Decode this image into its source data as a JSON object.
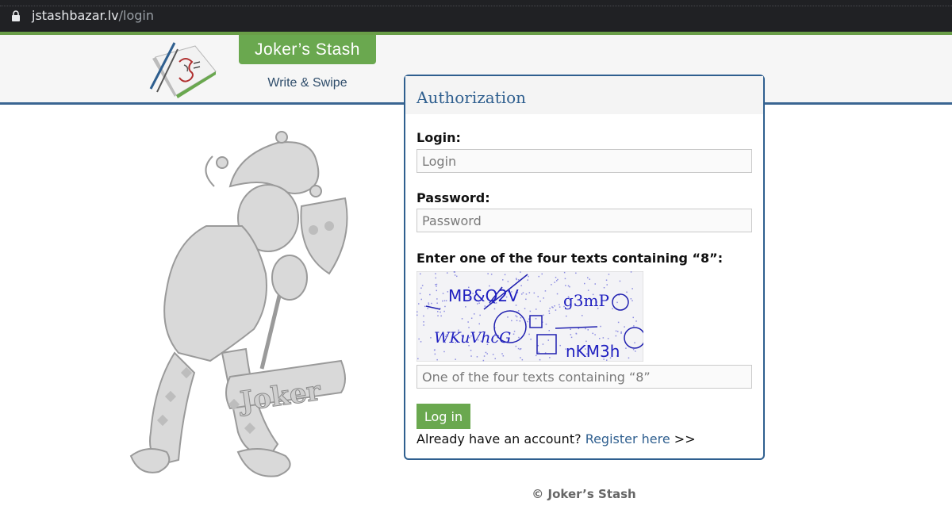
{
  "browser": {
    "url_host": "jstashbazar.lv",
    "url_path": "/login",
    "lock_icon": "lock-icon"
  },
  "header": {
    "brand": "Joker’s Stash",
    "tagline": "Write & Swipe",
    "colors": {
      "green": "#6aa84f",
      "blue": "#2f5f8f"
    }
  },
  "auth": {
    "title": "Authorization",
    "login_label": "Login:",
    "login_placeholder": "Login",
    "password_label": "Password:",
    "password_placeholder": "Password",
    "captcha_label": "Enter one of the four texts containing “8”:",
    "captcha_texts": [
      "MB&Q2V",
      "g3mP",
      "WKuVhcG",
      "nKM3h"
    ],
    "captcha_placeholder": "One of the four texts containing “8”",
    "login_button": "Log in",
    "register_prompt": "Already have an account?",
    "register_link": "Register here",
    "register_arrows": ">>"
  },
  "footer": {
    "copyright": "© Joker’s Stash"
  }
}
